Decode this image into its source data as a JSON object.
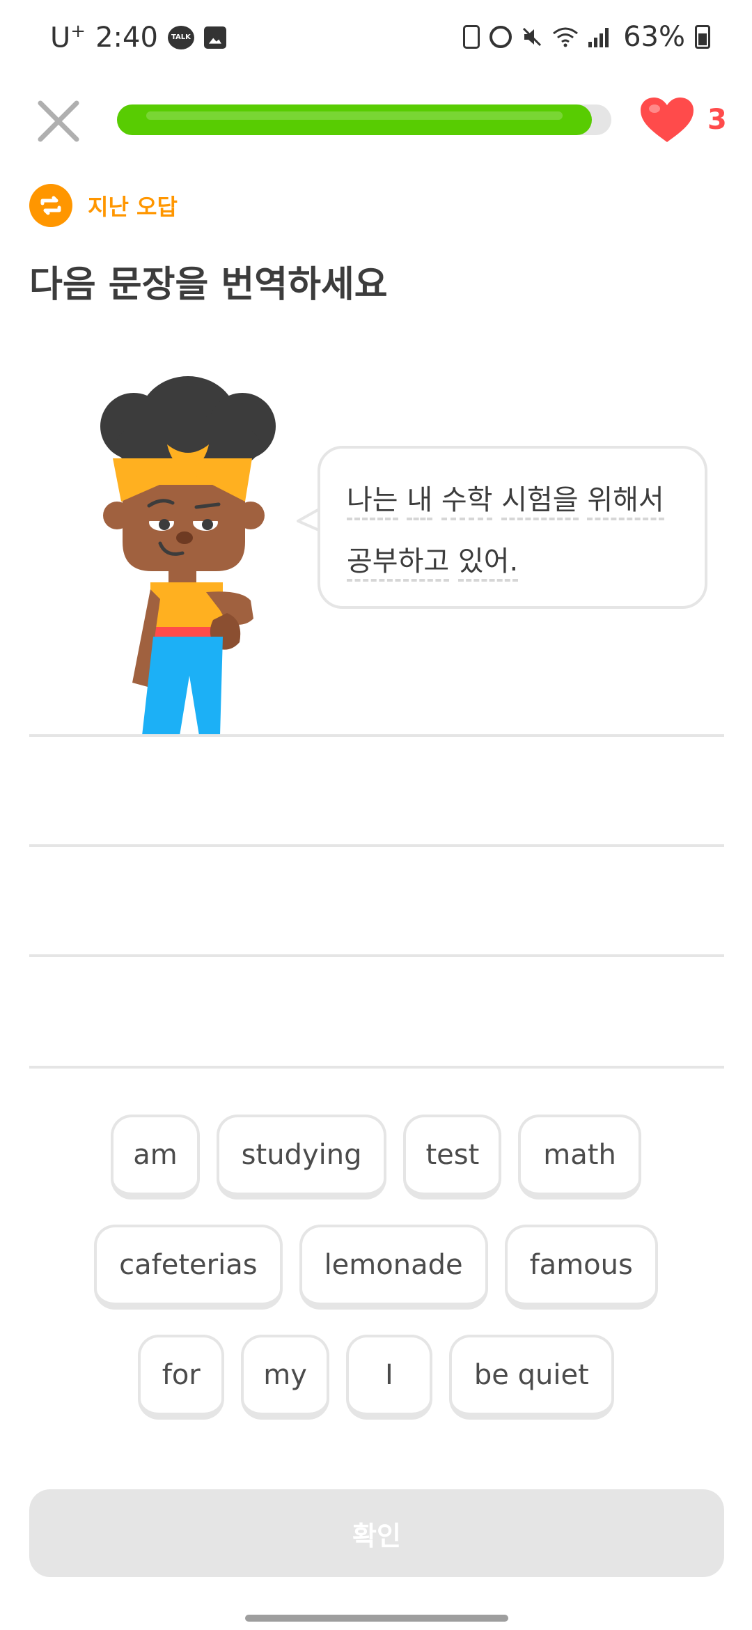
{
  "status_bar": {
    "carrier": "U",
    "carrier_sup": "+",
    "time": "2:40",
    "talk_label": "TALK",
    "battery_text": "63%"
  },
  "header": {
    "progress_fraction": 0.96,
    "hearts_count": "3"
  },
  "review": {
    "label": "지난 오답"
  },
  "prompt": {
    "title": "다음 문장을 번역하세요"
  },
  "speech": {
    "line1_words": [
      "나는",
      "내",
      "수학",
      "시험을",
      "위해서"
    ],
    "line2_words": [
      "공부하고",
      "있어."
    ]
  },
  "word_bank": {
    "row1": [
      "am",
      "studying",
      "test",
      "math"
    ],
    "row2": [
      "cafeterias",
      "lemonade",
      "famous"
    ],
    "row3": [
      "for",
      "my",
      "I",
      "be quiet"
    ]
  },
  "check_button": {
    "label": "확인"
  },
  "colors": {
    "progress": "#58cc02",
    "heart": "#ff4b4b",
    "review": "#ff9600",
    "disabled": "#e5e5e5"
  }
}
